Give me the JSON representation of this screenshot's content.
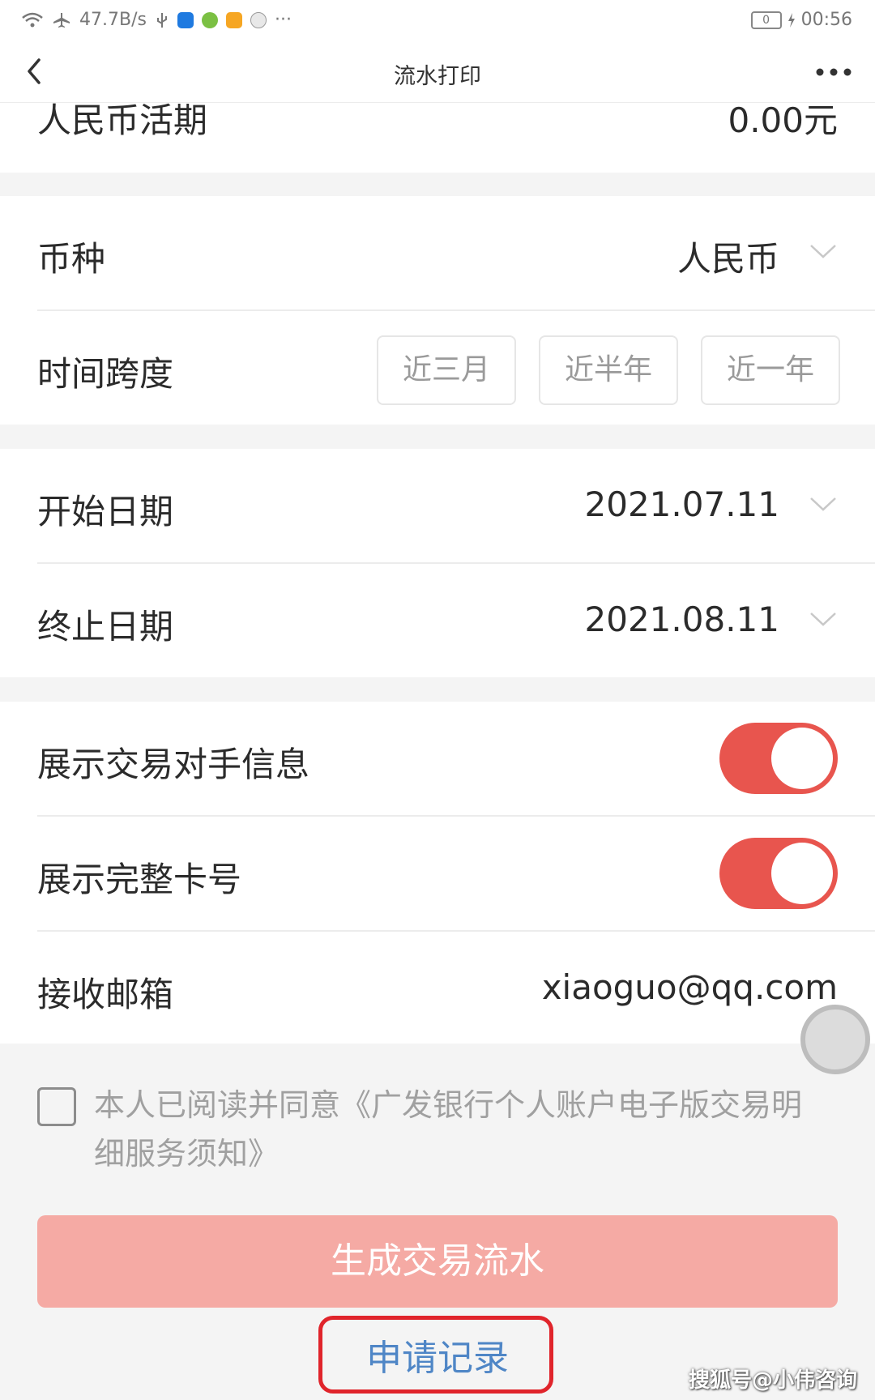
{
  "status_bar": {
    "network_speed": "47.7B/s",
    "more_notifications": "···",
    "battery_level": "0",
    "time": "00:56"
  },
  "nav": {
    "title": "流水打印"
  },
  "account": {
    "label": "人民币活期",
    "balance": "0.00元"
  },
  "currency": {
    "label": "币种",
    "value": "人民币"
  },
  "time_span": {
    "label": "时间跨度",
    "options": [
      "近三月",
      "近半年",
      "近一年"
    ]
  },
  "start_date": {
    "label": "开始日期",
    "value": "2021.07.11"
  },
  "end_date": {
    "label": "终止日期",
    "value": "2021.08.11"
  },
  "toggles": {
    "show_counterparty_label": "展示交易对手信息",
    "show_counterparty_on": true,
    "show_full_card_label": "展示完整卡号",
    "show_full_card_on": true
  },
  "email": {
    "label": "接收邮箱",
    "value": "xiaoguo@qq.com"
  },
  "agreement": {
    "text": "本人已阅读并同意《广发银行个人账户电子版交易明细服务须知》",
    "checked": false
  },
  "actions": {
    "generate_label": "生成交易流水",
    "records_label": "申请记录"
  },
  "watermark": "搜狐号@小伟咨询",
  "colors": {
    "accent_red": "#e8554e",
    "button_disabled": "#f5aaa4",
    "link_blue": "#4f86c6",
    "highlight_red": "#e0242b"
  }
}
